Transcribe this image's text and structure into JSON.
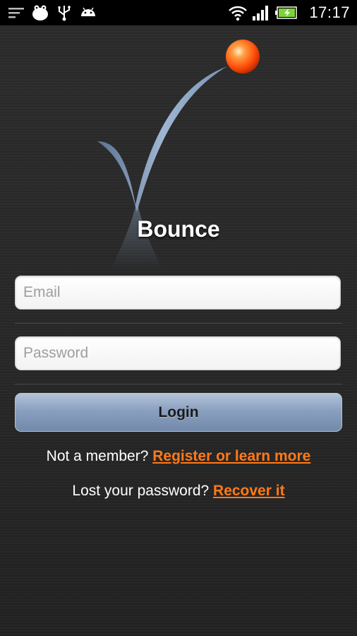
{
  "status_bar": {
    "icons_left": [
      "menu-icon",
      "app-notification-icon",
      "usb-icon",
      "android-icon"
    ],
    "icons_right": [
      "wifi-icon",
      "signal-icon",
      "battery-charging-icon"
    ],
    "time": "17:17",
    "colors": {
      "battery": "#7cd33a"
    }
  },
  "app": {
    "title": "Bounce"
  },
  "form": {
    "email_placeholder": "Email",
    "password_placeholder": "Password",
    "login_label": "Login"
  },
  "links": {
    "member_prompt": "Not a member?",
    "register_label": "Register or learn more",
    "lost_prompt": "Lost your password?",
    "recover_label": "Recover it"
  },
  "colors": {
    "link": "#ff7a1a",
    "button": "#8aa0bf",
    "ball": "#ff5a10"
  }
}
